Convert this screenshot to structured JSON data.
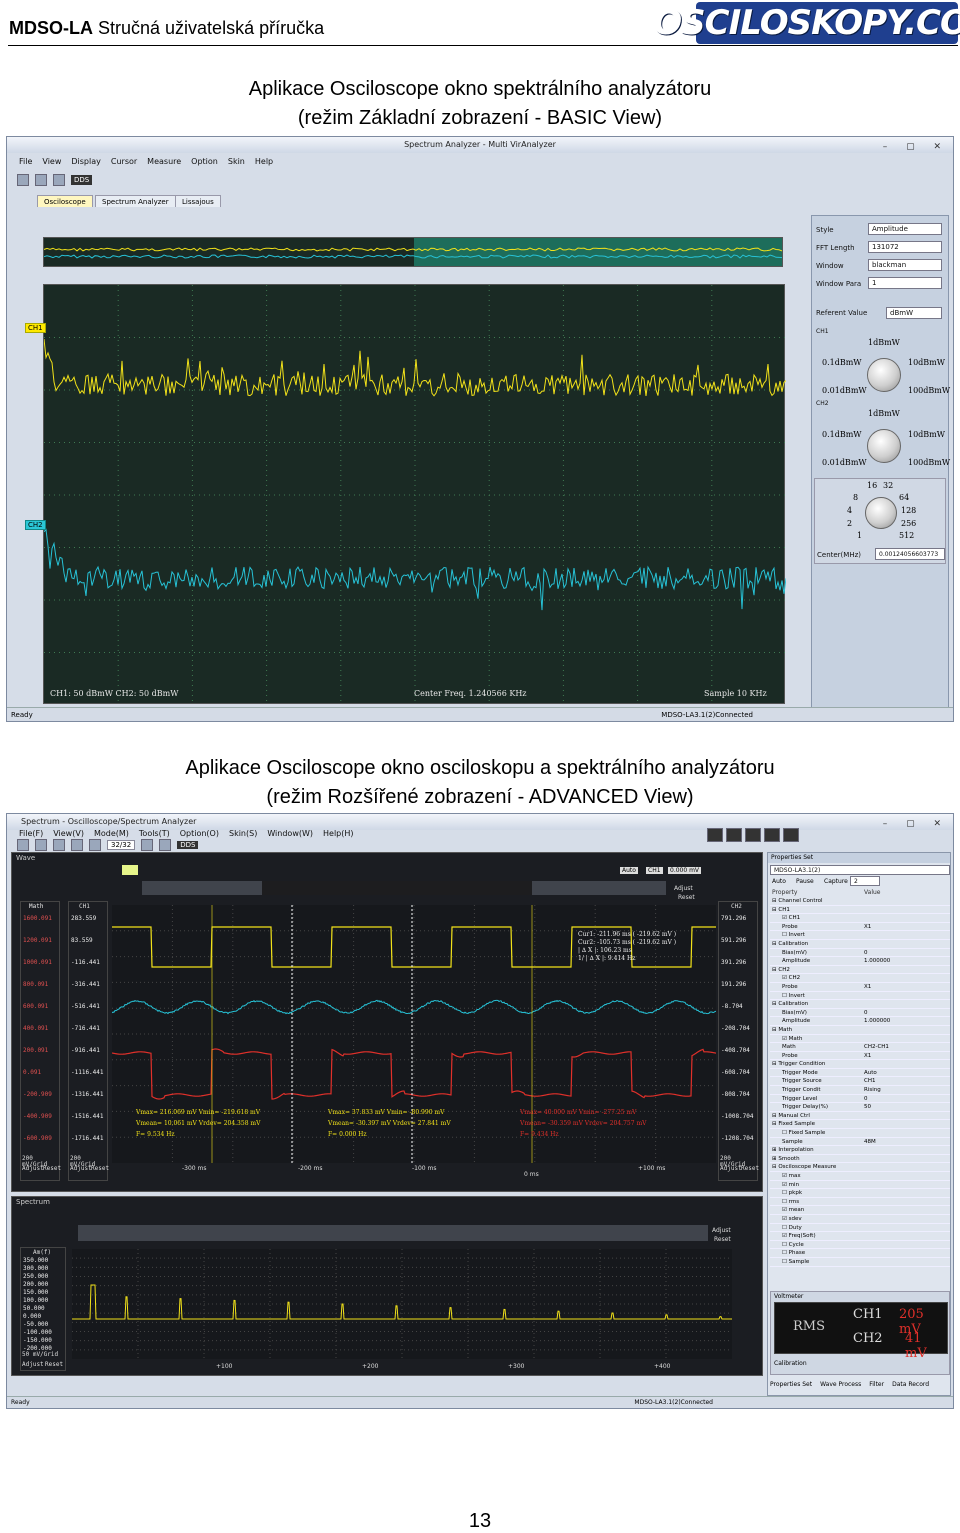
{
  "header": {
    "brand": "MDSO-LA",
    "subtitle": " Stručná uživatelská příručka",
    "logo_text": "OSCILOSKOPY.COM"
  },
  "section1": {
    "title_line1": "Aplikace Osciloscope okno spektrálního analyzátoru",
    "title_line2": "(režim Základní zobrazení - BASIC  View)"
  },
  "basic": {
    "window_title": "Spectrum Analyzer - Multi VirAnalyzer",
    "menu": [
      "File",
      "View",
      "Display",
      "Cursor",
      "Measure",
      "Option",
      "Skin",
      "Help"
    ],
    "toolbar_dds": "DDS",
    "tabs": [
      "Osciloscope",
      "Spectrum Analyzer",
      "Lissajous"
    ],
    "ch1_tag": "CH1",
    "ch2_tag": "CH2",
    "footer_left": "CH1: 50 dBmW   CH2: 50 dBmW",
    "footer_center": "Center Freq. 1.240566 KHz",
    "footer_right": "Sample 10 KHz",
    "status_left": "Ready",
    "status_right": "MDSO-LA3.1(2)Connected",
    "panel": {
      "style_label": "Style",
      "style_value": "Amplitude",
      "fft_label": "FFT Length",
      "fft_value": "131072",
      "window_label": "Window",
      "window_value": "blackman",
      "winpara_label": "Window Para",
      "winpara_value": "1",
      "ref_label": "Referent Value",
      "ref_value": "dBmW",
      "ch1": "CH1",
      "ch2": "CH2",
      "k_top": "1dBmW",
      "k_l1": "0.1dBmW",
      "k_r1": "10dBmW",
      "k_l2": "0.01dBmW",
      "k_r2": "100dBmW",
      "z_16": "16",
      "z_32": "32",
      "z_8": "8",
      "z_64": "64",
      "z_4": "4",
      "z_128": "128",
      "z_2": "2",
      "z_256": "256",
      "z_1": "1",
      "z_512": "512",
      "center_label": "Center(MHz)",
      "center_value": "0.00124056603773"
    }
  },
  "section2": {
    "title_line1": "Aplikace Osciloscope okno osciloskopu a spektrálního analyzátoru",
    "title_line2": "(režim Rozšířené zobrazení - ADVANCED View)"
  },
  "adv": {
    "window_title": "Spectrum - Oscilloscope/Spectrum Analyzer",
    "menu": [
      "File(F)",
      "View(V)",
      "Mode(M)",
      "Tools(T)",
      "Option(O)",
      "Skin(S)",
      "Window(W)",
      "Help(H)"
    ],
    "toolbar_zoom": "32/32",
    "toolbar_dds": "DDS",
    "wave_title": "Wave",
    "auto": "Auto",
    "ch1btn": "CH1",
    "trig_val": "0.000 mV",
    "adjust": "Adjust",
    "reset": "Reset",
    "left_axis_title": "Math",
    "ch1_title": "CH1",
    "ch2_title": "CH2",
    "math_ticks": [
      "1600.091",
      "1200.091",
      "1000.091",
      "800.091",
      "600.091",
      "400.091",
      "200.091",
      "0.091",
      "-200.909",
      "-400.909",
      "-600.909"
    ],
    "ch1_ticks": [
      "283.559",
      "83.559",
      "-116.441",
      "-316.441",
      "-516.441",
      "-716.441",
      "-916.441",
      "-1116.441",
      "-1316.441",
      "-1516.441",
      "-1716.441"
    ],
    "ch2_ticks": [
      "791.296",
      "591.296",
      "391.296",
      "191.296",
      "-8.704",
      "-208.704",
      "-408.704",
      "-608.704",
      "-808.704",
      "-1008.704",
      "-1208.704"
    ],
    "div_left": "200 mV/Grid",
    "div_mid": "200 mV/Grid",
    "div_right": "200 mV/Grid",
    "time_ticks": [
      "-300 ms",
      "-200 ms",
      "-100 ms",
      "0 ms",
      "+100 ms"
    ],
    "cursor_info": [
      "Cur1:   -211.96 ms  ( -219.62 mV )",
      "Cur2:   -105.73 ms  ( -219.62 mV )",
      "| ∆ X |:   106.23 ms",
      "1/ | ∆ X |:  9.414 Hz"
    ],
    "meas": [
      {
        "l1": "Vmax= 216.069 mV  Vmin= -219.618 mV",
        "l2": "Vmean= 10.061 mV   Vrdev= 204.358 mV",
        "l3": "F= 9.534 Hz"
      },
      {
        "l1": "Vmax= 37.833 mV   Vmin= -80.990 mV",
        "l2": "Vmean= -30.397 mV   Vrdev= 27.841 mV",
        "l3": "F= 0.000 Hz"
      },
      {
        "l1": "Vmax= 40.000 mV   Vmin= -277.25 mV",
        "l2": "Vmean= -30.359 mV   Vrdev= 204.757 mV",
        "l3": "F= 9.434 Hz"
      }
    ],
    "spectrum_title": "Spectrum",
    "spec_axis_title": "Am(f)",
    "spec_ticks": [
      "350.000",
      "300.000",
      "250.000",
      "200.000",
      "150.000",
      "100.000",
      "50.000",
      "0.000",
      "-50.000",
      "-100.000",
      "-150.000",
      "-200.000"
    ],
    "spec_div": "50 mV/Grid",
    "spec_x_ticks": [
      "+100",
      "+200",
      "+300",
      "+400"
    ],
    "props_title": "Properties Set",
    "device": "MDSO-LA3.1(2)",
    "props_auto": "Auto",
    "props_pause": "Pause",
    "props_capture": "Capture",
    "props_capture_val": "2",
    "prop_col": "Property",
    "val_col": "Value",
    "prop_rows": [
      [
        "⊟ Channel Control",
        ""
      ],
      [
        "⊟ CH1",
        ""
      ],
      [
        "☑ CH1",
        ""
      ],
      [
        "Probe",
        "X1"
      ],
      [
        "☐ Invert",
        ""
      ],
      [
        "⊟ Calibration",
        ""
      ],
      [
        "Bias(mV)",
        "0"
      ],
      [
        "Amplitude",
        "1.000000"
      ],
      [
        "⊟ CH2",
        ""
      ],
      [
        "☑ CH2",
        ""
      ],
      [
        "Probe",
        "X1"
      ],
      [
        "☐ Invert",
        ""
      ],
      [
        "⊟ Calibration",
        ""
      ],
      [
        "Bias(mV)",
        "0"
      ],
      [
        "Amplitude",
        "1.000000"
      ],
      [
        "⊟ Math",
        ""
      ],
      [
        "☑ Math",
        ""
      ],
      [
        "Math",
        "CH2-CH1"
      ],
      [
        "Probe",
        "X1"
      ],
      [
        "⊟ Trigger Condition",
        ""
      ],
      [
        "Trigger Mode",
        "Auto"
      ],
      [
        "Trigger Source",
        "CH1"
      ],
      [
        "Trigger Condit",
        "Rising"
      ],
      [
        "Trigger Level",
        "0"
      ],
      [
        "Trigger Delay(%)",
        "50"
      ],
      [
        "⊟ Manual Ctrl",
        ""
      ],
      [
        "⊟ Fixed Sample",
        ""
      ],
      [
        "☐ Fixed Sample",
        ""
      ],
      [
        "Sample",
        "48M"
      ],
      [
        "⊞ Interpolation",
        ""
      ],
      [
        "⊞ Smooth",
        ""
      ],
      [
        "⊟ Osciloscope Measure",
        ""
      ],
      [
        "☑ max",
        ""
      ],
      [
        "☑ min",
        ""
      ],
      [
        "☐ pkpk",
        ""
      ],
      [
        "☐ rms",
        ""
      ],
      [
        "☑ mean",
        ""
      ],
      [
        "☑ sdev",
        ""
      ],
      [
        "☐ Duty",
        ""
      ],
      [
        "☑ Freq(Soft)",
        ""
      ],
      [
        "☐ Cycle",
        ""
      ],
      [
        "☐ Phase",
        ""
      ],
      [
        "☐ Sample",
        ""
      ]
    ],
    "voltmeter_title": "Voltmeter",
    "vm_rms": "RMS",
    "vm_ch1": "CH1",
    "vm_ch1_val": "205 mV",
    "vm_ch2": "CH2",
    "vm_ch2_val": "41 mV",
    "calibration": "Calibration",
    "bottom_tabs": [
      "Properties Set",
      "Wave Process",
      "Filter",
      "Data Record"
    ],
    "status_left": "Ready",
    "status_right": "MDSO-LA3.1(2)Connected"
  },
  "page_number": "13",
  "colors": {
    "ch1": "#f2e21a",
    "ch2": "#27c2d6",
    "math": "#e0302a",
    "plotbg": "#1b2b25",
    "darkbg": "#1b1d22"
  }
}
